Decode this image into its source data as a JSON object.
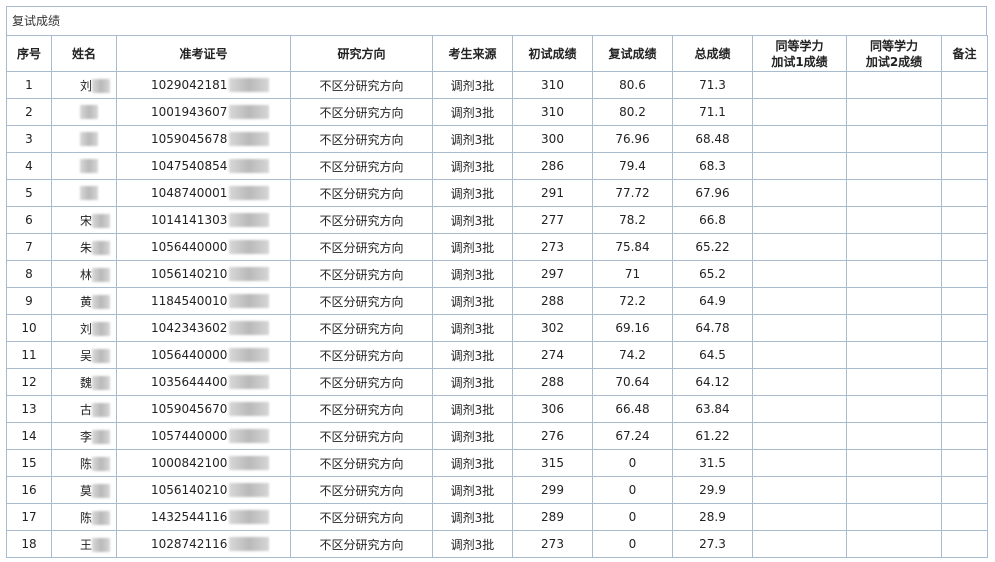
{
  "title": "复试成绩",
  "headers": [
    "序号",
    "姓名",
    "准考证号",
    "研究方向",
    "考生来源",
    "初试成绩",
    "复试成绩",
    "总成绩",
    "同等学力加试1成绩",
    "同等学力加试2成绩",
    "备注"
  ],
  "header_lines": {
    "eq1_line1": "同等学力",
    "eq1_line2": "加试1成绩",
    "eq2_line1": "同等学力",
    "eq2_line2": "加试2成绩"
  },
  "rows": [
    {
      "no": "1",
      "name": "刘",
      "id": "1029042181",
      "dir": "不区分研究方向",
      "src": "调剂3批",
      "init": "310",
      "re": "80.6",
      "total": "71.3"
    },
    {
      "no": "2",
      "name": "",
      "id": "1001943607",
      "dir": "不区分研究方向",
      "src": "调剂3批",
      "init": "310",
      "re": "80.2",
      "total": "71.1"
    },
    {
      "no": "3",
      "name": "",
      "id": "1059045678",
      "dir": "不区分研究方向",
      "src": "调剂3批",
      "init": "300",
      "re": "76.96",
      "total": "68.48"
    },
    {
      "no": "4",
      "name": "",
      "id": "1047540854",
      "dir": "不区分研究方向",
      "src": "调剂3批",
      "init": "286",
      "re": "79.4",
      "total": "68.3"
    },
    {
      "no": "5",
      "name": "",
      "id": "1048740001",
      "dir": "不区分研究方向",
      "src": "调剂3批",
      "init": "291",
      "re": "77.72",
      "total": "67.96"
    },
    {
      "no": "6",
      "name": "宋",
      "id": "1014141303",
      "dir": "不区分研究方向",
      "src": "调剂3批",
      "init": "277",
      "re": "78.2",
      "total": "66.8"
    },
    {
      "no": "7",
      "name": "朱",
      "id": "1056440000",
      "dir": "不区分研究方向",
      "src": "调剂3批",
      "init": "273",
      "re": "75.84",
      "total": "65.22"
    },
    {
      "no": "8",
      "name": "林",
      "id": "1056140210",
      "dir": "不区分研究方向",
      "src": "调剂3批",
      "init": "297",
      "re": "71",
      "total": "65.2"
    },
    {
      "no": "9",
      "name": "黄",
      "id": "1184540010",
      "dir": "不区分研究方向",
      "src": "调剂3批",
      "init": "288",
      "re": "72.2",
      "total": "64.9"
    },
    {
      "no": "10",
      "name": "刘",
      "id": "1042343602",
      "dir": "不区分研究方向",
      "src": "调剂3批",
      "init": "302",
      "re": "69.16",
      "total": "64.78"
    },
    {
      "no": "11",
      "name": "吴",
      "id": "1056440000",
      "dir": "不区分研究方向",
      "src": "调剂3批",
      "init": "274",
      "re": "74.2",
      "total": "64.5"
    },
    {
      "no": "12",
      "name": "魏",
      "id": "1035644400",
      "dir": "不区分研究方向",
      "src": "调剂3批",
      "init": "288",
      "re": "70.64",
      "total": "64.12"
    },
    {
      "no": "13",
      "name": "古",
      "id": "1059045670",
      "dir": "不区分研究方向",
      "src": "调剂3批",
      "init": "306",
      "re": "66.48",
      "total": "63.84"
    },
    {
      "no": "14",
      "name": "李",
      "id": "1057440000",
      "dir": "不区分研究方向",
      "src": "调剂3批",
      "init": "276",
      "re": "67.24",
      "total": "61.22"
    },
    {
      "no": "15",
      "name": "陈",
      "id": "1000842100",
      "dir": "不区分研究方向",
      "src": "调剂3批",
      "init": "315",
      "re": "0",
      "total": "31.5"
    },
    {
      "no": "16",
      "name": "莫",
      "id": "1056140210",
      "dir": "不区分研究方向",
      "src": "调剂3批",
      "init": "299",
      "re": "0",
      "total": "29.9"
    },
    {
      "no": "17",
      "name": "陈",
      "id": "1432544116",
      "dir": "不区分研究方向",
      "src": "调剂3批",
      "init": "289",
      "re": "0",
      "total": "28.9"
    },
    {
      "no": "18",
      "name": "王",
      "id": "1028742116",
      "dir": "不区分研究方向",
      "src": "调剂3批",
      "init": "273",
      "re": "0",
      "total": "27.3"
    }
  ]
}
